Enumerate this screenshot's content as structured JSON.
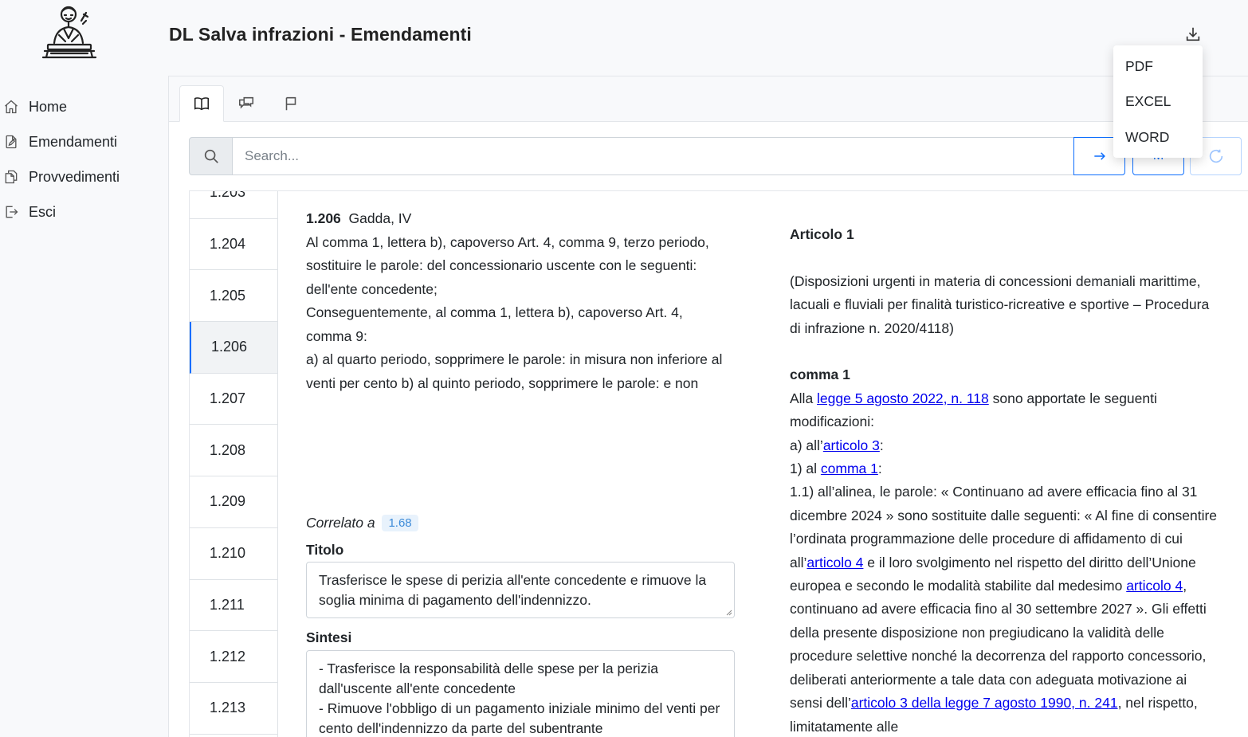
{
  "header": {
    "title": "DL Salva infrazioni - Emendamenti"
  },
  "sidebar": {
    "items": [
      {
        "label": "Home",
        "icon": "home-icon"
      },
      {
        "label": "Emendamenti",
        "icon": "edit-document-icon"
      },
      {
        "label": "Provvedimenti",
        "icon": "documents-icon"
      },
      {
        "label": "Esci",
        "icon": "logout-icon"
      }
    ]
  },
  "tabs": [
    {
      "icon": "book-icon",
      "active": true
    },
    {
      "icon": "chat-icon",
      "active": false
    },
    {
      "icon": "flag-icon",
      "active": false
    }
  ],
  "search": {
    "placeholder": "Search...",
    "m_label": "M"
  },
  "download_menu": {
    "items": [
      "PDF",
      "EXCEL",
      "WORD"
    ]
  },
  "amendments_list": [
    {
      "label": "1.203"
    },
    {
      "label": "1.204"
    },
    {
      "label": "1.205"
    },
    {
      "label": "1.206",
      "active": true
    },
    {
      "label": "1.207"
    },
    {
      "label": "1.208"
    },
    {
      "label": "1.209"
    },
    {
      "label": "1.210"
    },
    {
      "label": "1.211"
    },
    {
      "label": "1.212"
    },
    {
      "label": "1.213"
    }
  ],
  "amendment": {
    "number": "1.206",
    "author": "Gadda, IV",
    "text_1": "Al comma 1, lettera b), capoverso Art. 4, comma 9, terzo periodo, sostituire le parole: del concessionario uscente con le seguenti: dell'ente concedente;",
    "text_2": "Conseguentemente, al comma 1, lettera b), capoverso Art. 4, comma 9:",
    "text_3": "a) al quarto periodo, sopprimere le parole: in misura non inferiore al venti per cento b) al quinto periodo, sopprimere le parole: e non",
    "correlato_label": "Correlato a",
    "correlato_value": "1.68",
    "titolo_label": "Titolo",
    "titolo_value": "Trasferisce le spese di perizia all'ente concedente e rimuove la soglia minima di pagamento dell'indennizzo.",
    "sintesi_label": "Sintesi",
    "sintesi_line_1": "- Trasferisce la responsabilità delle spese per la perizia dall'uscente all'ente concedente",
    "sintesi_line_2": "- Rimuove l'obbligo di un pagamento iniziale minimo del venti per cento dell'indennizzo da parte del subentrante"
  },
  "article": {
    "heading": "Articolo 1",
    "subtitle": "(Disposizioni urgenti in materia di concessioni demaniali marittime, lacuali e fluviali per finalità turistico-ricreative e sportive – Procedura di infrazione n. 2020/4118)",
    "comma_heading": "comma 1",
    "p1_a": "Alla ",
    "p1_link": "legge 5 agosto 2022, n. 118",
    "p1_b": " sono apportate le seguenti modificazioni:",
    "p2_a": "a) all’",
    "p2_link": "articolo 3",
    "p2_b": ":",
    "p3_a": "1) al ",
    "p3_link": "comma 1",
    "p3_b": ":",
    "p4_a": "1.1) all’alinea, le parole: « Continuano ad avere efficacia fino al 31 dicembre 2024 » sono sostituite dalle seguenti: « Al fine di consentire l’ordinata programmazione delle procedure di affidamento di cui all’",
    "p4_link1": "articolo 4",
    "p4_b": " e il loro svolgimento nel rispetto del diritto dell’Unione europea e secondo le modalità stabilite dal medesimo ",
    "p4_link2": "articolo 4",
    "p4_c": ", continuano ad avere efficacia fino al 30 settembre 2027 ». Gli effetti della presente disposizione non pregiudicano la validità delle procedure selettive nonché la decorrenza del rapporto concessorio, deliberati anteriormente a tale data con adeguata motivazione ai sensi dell’",
    "p4_link3": "articolo 3 della legge 7 agosto 1990, n. 241",
    "p4_d": ", nel rispetto, limitatamente alle"
  },
  "colors": {
    "accent": "#0d6efd",
    "badge_text": "#3d8bd8",
    "link": "#0000ee"
  }
}
